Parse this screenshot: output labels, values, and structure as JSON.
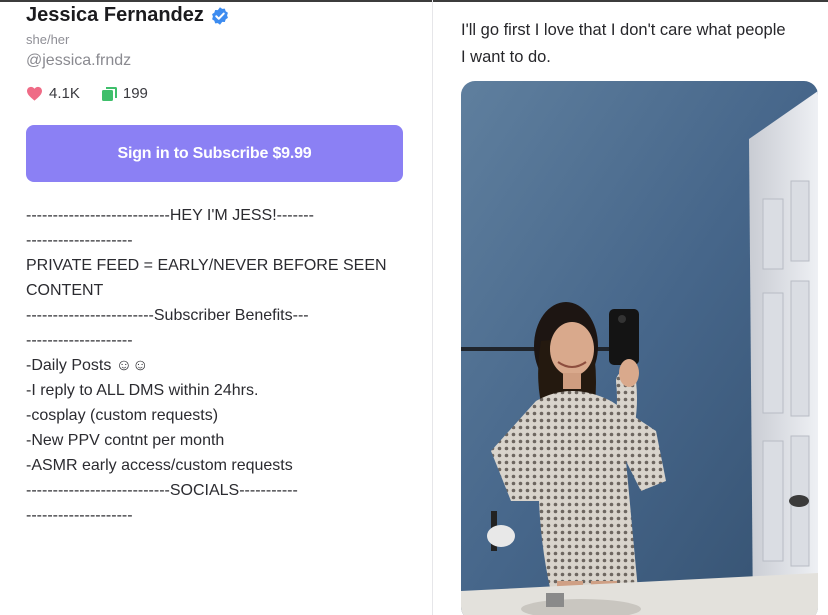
{
  "profile": {
    "name": "Jessica Fernandez",
    "pronouns": "she/her",
    "handle": "@jessica.frndz",
    "likes": "4.1K",
    "posts": "199",
    "subscribe_label": "Sign in to Subscribe $9.99"
  },
  "bio": {
    "lines": [
      "---------------------------HEY I'M JESS!-------",
      "--------------------",
      "",
      "PRIVATE FEED = EARLY/NEVER BEFORE SEEN",
      "CONTENT",
      "",
      "------------------------Subscriber Benefits---",
      "--------------------",
      "",
      "-Daily Posts ☺☺",
      "-I reply to ALL DMS within 24hrs.",
      "-cosplay (custom requests)",
      "-New PPV contnt per month",
      "-ASMR early access/custom requests",
      "",
      "---------------------------SOCIALS-----------",
      "--------------------"
    ]
  },
  "post": {
    "text_line1": "I'll go first I love that I don't care what people",
    "text_line2": "I want to do."
  },
  "colors": {
    "accent": "#8b80f4",
    "verified": "#3d8cf0",
    "like": "#ef6b86",
    "posts": "#3fbf6b"
  },
  "icons": {
    "verified": "verified-badge-icon",
    "likes": "heart-icon",
    "posts": "post-count-icon"
  }
}
